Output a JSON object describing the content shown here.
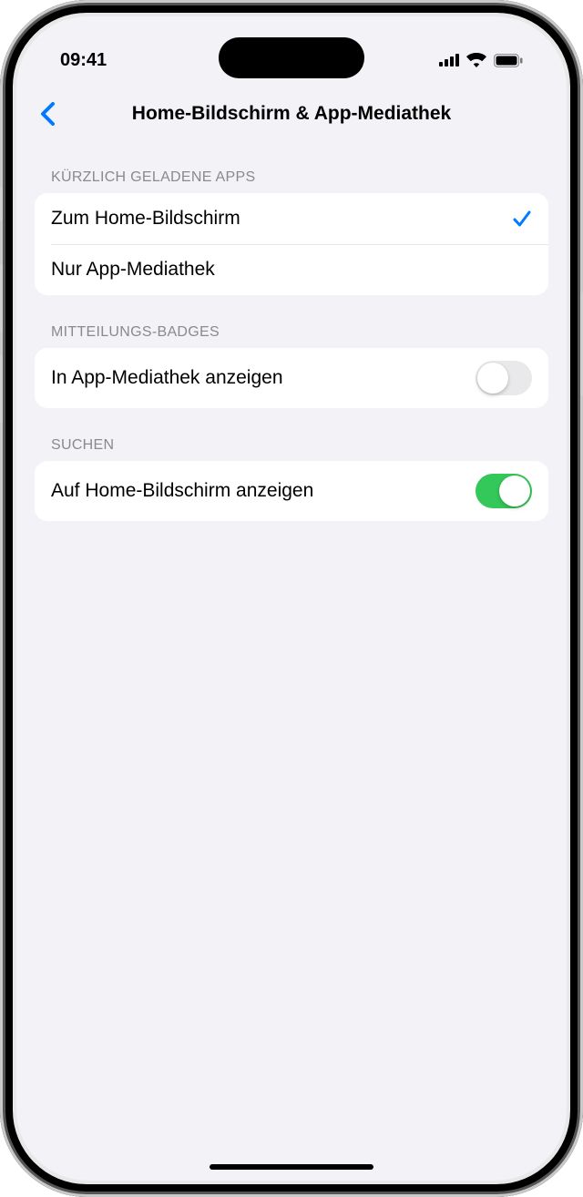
{
  "status": {
    "time": "09:41"
  },
  "nav": {
    "title": "Home-Bildschirm & App-Mediathek"
  },
  "sections": {
    "recent": {
      "header": "KÜRZLICH GELADENE APPS",
      "options": [
        {
          "label": "Zum Home-Bildschirm",
          "selected": true
        },
        {
          "label": "Nur App-Mediathek",
          "selected": false
        }
      ]
    },
    "badges": {
      "header": "MITTEILUNGS-BADGES",
      "row": {
        "label": "In App-Mediathek anzeigen",
        "enabled": false
      }
    },
    "search": {
      "header": "SUCHEN",
      "row": {
        "label": "Auf Home-Bildschirm anzeigen",
        "enabled": true
      }
    }
  }
}
